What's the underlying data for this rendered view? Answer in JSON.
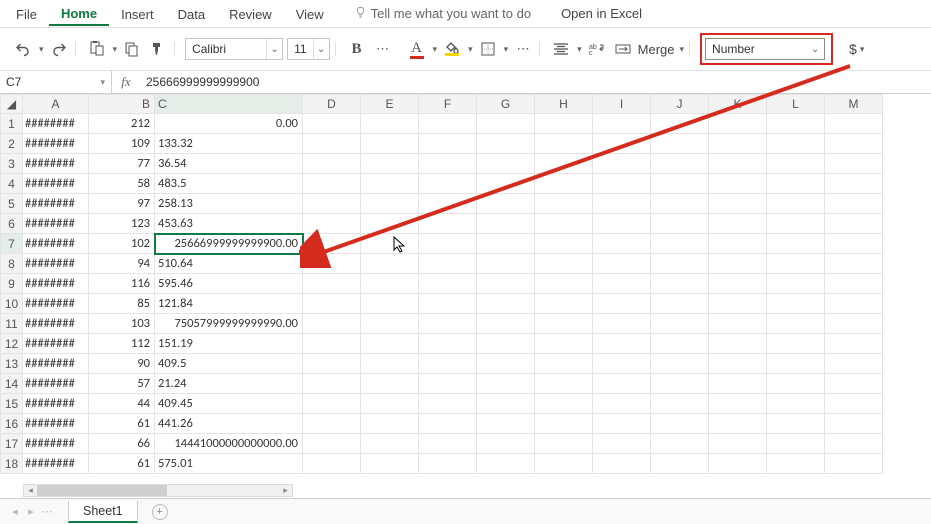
{
  "menu": {
    "file": "File",
    "home": "Home",
    "insert": "Insert",
    "data": "Data",
    "review": "Review",
    "view": "View",
    "tellme": "Tell me what you want to do",
    "openexcel": "Open in Excel"
  },
  "ribbon": {
    "font_name": "Calibri",
    "font_size": "11",
    "merge_label": "Merge",
    "number_format": "Number"
  },
  "namebox": "C7",
  "formula_value": "25666999999999900",
  "columns": [
    "A",
    "B",
    "C",
    "D",
    "E",
    "F",
    "G",
    "H",
    "I",
    "J",
    "K",
    "L",
    "M"
  ],
  "rows": [
    {
      "n": 1,
      "a": "########",
      "b": "212",
      "c": "0.00",
      "cnum": true
    },
    {
      "n": 2,
      "a": "########",
      "b": "109",
      "c": "133.32"
    },
    {
      "n": 3,
      "a": "########",
      "b": "77",
      "c": "36.54"
    },
    {
      "n": 4,
      "a": "########",
      "b": "58",
      "c": "483.5"
    },
    {
      "n": 5,
      "a": "########",
      "b": "97",
      "c": "258.13"
    },
    {
      "n": 6,
      "a": "########",
      "b": "123",
      "c": "453.63"
    },
    {
      "n": 7,
      "a": "########",
      "b": "102",
      "c": "25666999999999900.00",
      "cnum": true,
      "sel": true
    },
    {
      "n": 8,
      "a": "########",
      "b": "94",
      "c": "510.64"
    },
    {
      "n": 9,
      "a": "########",
      "b": "116",
      "c": "595.46"
    },
    {
      "n": 10,
      "a": "########",
      "b": "85",
      "c": "121.84"
    },
    {
      "n": 11,
      "a": "########",
      "b": "103",
      "c": "75057999999999990.00",
      "cnum": true
    },
    {
      "n": 12,
      "a": "########",
      "b": "112",
      "c": "151.19"
    },
    {
      "n": 13,
      "a": "########",
      "b": "90",
      "c": "409.5"
    },
    {
      "n": 14,
      "a": "########",
      "b": "57",
      "c": "21.24"
    },
    {
      "n": 15,
      "a": "########",
      "b": "44",
      "c": "409.45"
    },
    {
      "n": 16,
      "a": "########",
      "b": "61",
      "c": "441.26"
    },
    {
      "n": 17,
      "a": "########",
      "b": "66",
      "c": "14441000000000000.00",
      "cnum": true
    },
    {
      "n": 18,
      "a": "########",
      "b": "61",
      "c": "575.01"
    }
  ],
  "sheet_tab": "Sheet1"
}
